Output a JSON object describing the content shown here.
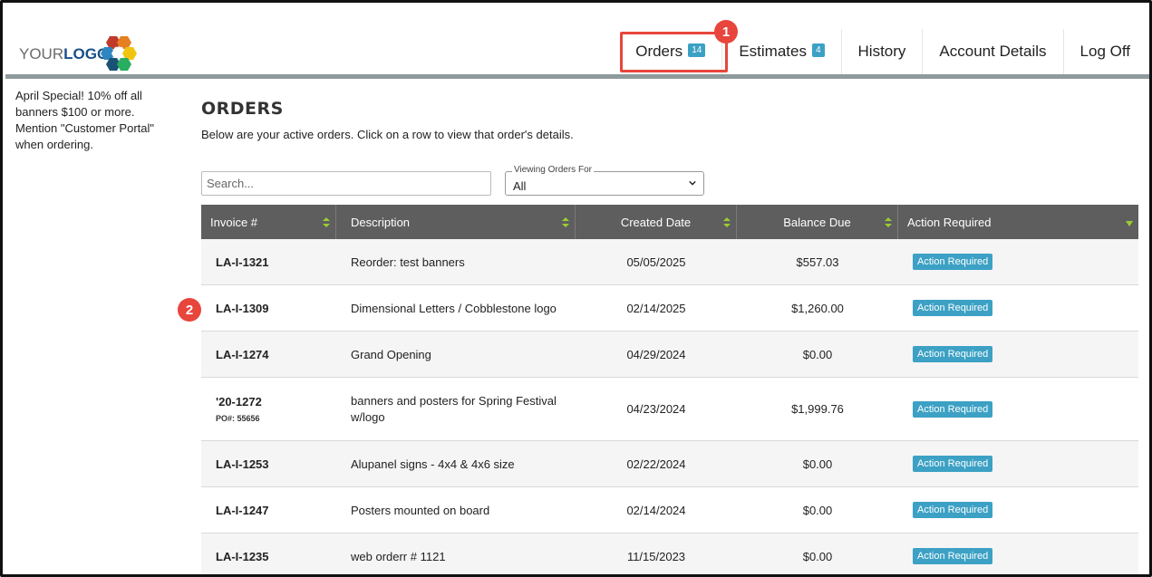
{
  "header": {
    "logo": {
      "part1": "YOUR",
      "part2": "LOGO"
    },
    "nav": [
      {
        "label": "Orders",
        "badge": "14"
      },
      {
        "label": "Estimates",
        "badge": "4"
      },
      {
        "label": "History"
      },
      {
        "label": "Account Details"
      },
      {
        "label": "Log Off"
      }
    ]
  },
  "callouts": {
    "one": "1",
    "two": "2"
  },
  "sidebar": {
    "promo": "April Special! 10% off all banners $100 or more. Mention \"Customer Portal\" when ordering."
  },
  "main": {
    "title": "ORDERS",
    "description": "Below are your active orders. Click on a row to view that order's details."
  },
  "search": {
    "placeholder": "Search..."
  },
  "filter": {
    "label": "Viewing Orders For",
    "value": "All"
  },
  "table": {
    "headers": [
      "Invoice #",
      "Description",
      "Created Date",
      "Balance Due",
      "Action Required"
    ],
    "rows": [
      {
        "invoice": "LA-I-1321",
        "po": "",
        "description": "Reorder: test banners",
        "date": "05/05/2025",
        "balance": "$557.03",
        "action": "Action Required"
      },
      {
        "invoice": "LA-I-1309",
        "po": "",
        "description": "Dimensional Letters / Cobblestone logo",
        "date": "02/14/2025",
        "balance": "$1,260.00",
        "action": "Action Required"
      },
      {
        "invoice": "LA-I-1274",
        "po": "",
        "description": "Grand Opening",
        "date": "04/29/2024",
        "balance": "$0.00",
        "action": "Action Required"
      },
      {
        "invoice": "'20-1272",
        "po": "PO#: 55656",
        "description": "banners and posters for Spring Festival w/logo",
        "date": "04/23/2024",
        "balance": "$1,999.76",
        "action": "Action Required"
      },
      {
        "invoice": "LA-I-1253",
        "po": "",
        "description": "Alupanel signs - 4x4 & 4x6 size",
        "date": "02/22/2024",
        "balance": "$0.00",
        "action": "Action Required"
      },
      {
        "invoice": "LA-I-1247",
        "po": "",
        "description": "Posters mounted on board",
        "date": "02/14/2024",
        "balance": "$0.00",
        "action": "Action Required"
      },
      {
        "invoice": "LA-I-1235",
        "po": "",
        "description": "web orderr # 1121",
        "date": "11/15/2023",
        "balance": "$0.00",
        "action": "Action Required"
      }
    ]
  },
  "colors": {
    "accent": "#3ca1c4",
    "callout": "#e8453c",
    "header_bar": "#8e9a9c",
    "table_header": "#5e5e5e",
    "sort_icon": "#9acd32"
  }
}
